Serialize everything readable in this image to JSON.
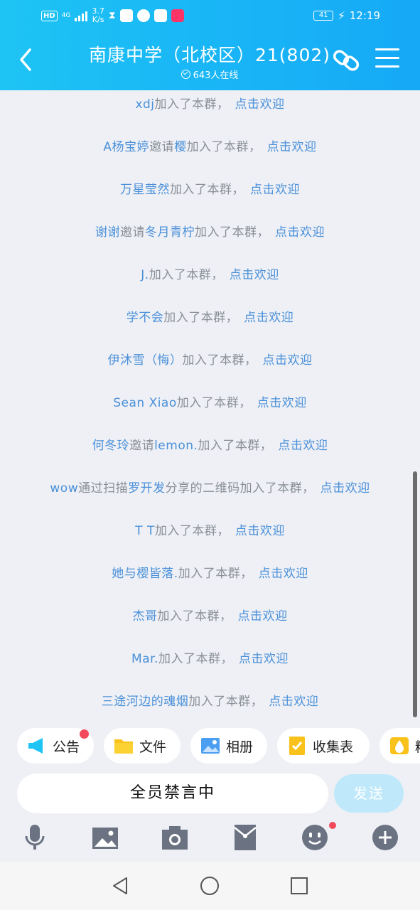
{
  "status_bar": {
    "hd": "HD",
    "net": "4G",
    "speed_value": "3.7",
    "speed_unit": "K/s",
    "battery": "41",
    "time": "12:19"
  },
  "header": {
    "title": "南康中学（北校区）21(802)",
    "online": "643人在线"
  },
  "welcome_label": "点击欢迎",
  "messages": [
    {
      "pre": "",
      "user": "xdj",
      "mid": "",
      "target": "",
      "action": "加入了本群，"
    },
    {
      "pre": "",
      "user": "A杨宝婷",
      "mid": "邀请",
      "target": "樱",
      "action": "加入了本群，"
    },
    {
      "pre": "",
      "user": "万星莹然",
      "mid": "",
      "target": "",
      "action": "加入了本群，"
    },
    {
      "pre": "",
      "user": "谢谢",
      "mid": "邀请",
      "target": "冬月青柠",
      "action": "加入了本群，"
    },
    {
      "pre": "",
      "user": "J.",
      "mid": "",
      "target": "",
      "action": "加入了本群，"
    },
    {
      "pre": "",
      "user": "学不会",
      "mid": "",
      "target": "",
      "action": "加入了本群，"
    },
    {
      "pre": "",
      "user": "伊沐雪（悔）",
      "mid": "",
      "target": "",
      "action": "加入了本群，"
    },
    {
      "pre": "",
      "user": "Sean Xiao",
      "mid": "",
      "target": "",
      "action": "加入了本群，"
    },
    {
      "pre": "",
      "user": "何冬玲",
      "mid": "邀请",
      "target": "lemon.",
      "action": "加入了本群，"
    },
    {
      "pre": "",
      "user": "wow",
      "mid": "通过扫描",
      "target": "罗开发",
      "action": "分享的二维码加入了本群，"
    },
    {
      "pre": "",
      "user": "T T",
      "mid": "",
      "target": "",
      "action": "加入了本群，"
    },
    {
      "pre": "",
      "user": "她与樱皆落.",
      "mid": "",
      "target": "",
      "action": "加入了本群，"
    },
    {
      "pre": "",
      "user": "杰哥",
      "mid": "",
      "target": "",
      "action": "加入了本群，"
    },
    {
      "pre": "",
      "user": "Mar.",
      "mid": "",
      "target": "",
      "action": "加入了本群，"
    },
    {
      "pre": "",
      "user": "三途河边的魂烟",
      "mid": "",
      "target": "",
      "action": "加入了本群，"
    }
  ],
  "tools": [
    {
      "label": "公告",
      "icon": "megaphone-icon",
      "badge": true
    },
    {
      "label": "文件",
      "icon": "folder-icon",
      "badge": false
    },
    {
      "label": "相册",
      "icon": "album-icon",
      "badge": false
    },
    {
      "label": "收集表",
      "icon": "checklist-icon",
      "badge": false
    },
    {
      "label": "精",
      "icon": "essence-icon",
      "badge": false
    }
  ],
  "input": {
    "muted_text": "全员禁言中",
    "send_label": "发送"
  },
  "bottom_icons": [
    "microphone-icon",
    "image-icon",
    "camera-icon",
    "red-packet-icon",
    "emoji-icon",
    "plus-icon"
  ],
  "colors": {
    "header": "#19b6f6",
    "link": "#4a90d9",
    "text": "#8a8f98",
    "badge": "#f24a5a"
  }
}
